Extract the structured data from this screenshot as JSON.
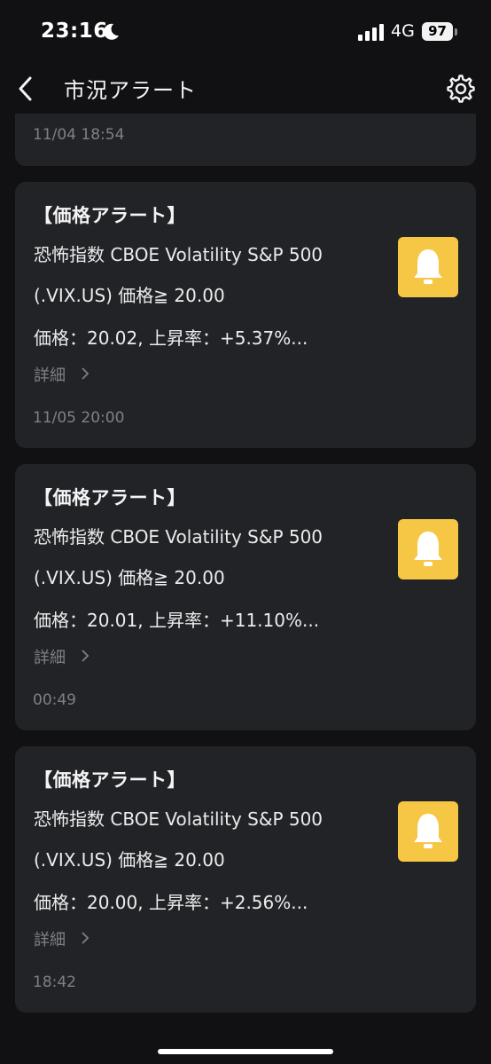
{
  "status_bar": {
    "time": "23:16",
    "network": "4G",
    "battery": "97"
  },
  "nav": {
    "title": "市況アラート",
    "icons": [
      "chevron-left-icon",
      "gear-icon"
    ]
  },
  "partial_card": {
    "time": "11/04 18:54"
  },
  "alerts": [
    {
      "heading": "【価格アラート】",
      "line1": "恐怖指数 CBOE Volatility S&P 500",
      "line2": "(.VIX.US) 価格≧ 20.00",
      "line3": "価格：20.02,  上昇率：+5.37%...",
      "detail": "詳細",
      "time": "11/05 20:00"
    },
    {
      "heading": "【価格アラート】",
      "line1": "恐怖指数 CBOE Volatility S&P 500",
      "line2": "(.VIX.US) 価格≧ 20.00",
      "line3": "価格：20.01,  上昇率：+11.10%...",
      "detail": "詳細",
      "time": "00:49"
    },
    {
      "heading": "【価格アラート】",
      "line1": "恐怖指数 CBOE Volatility S&P 500",
      "line2": "(.VIX.US) 価格≧ 20.00",
      "line3": "価格：20.00,  上昇率：+2.56%...",
      "detail": "詳細",
      "time": "18:42"
    }
  ],
  "colors": {
    "background": "#111113",
    "card": "#222326",
    "bell_accent": "#f6c744",
    "muted_text": "#7f8086"
  }
}
